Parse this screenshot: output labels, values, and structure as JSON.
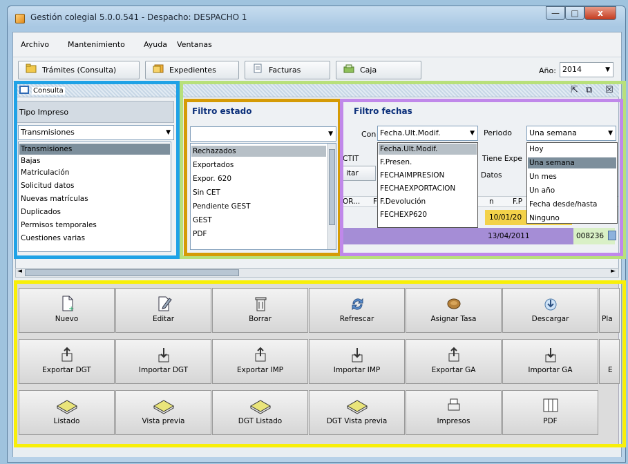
{
  "window": {
    "title": "Gestión colegial 5.0.0.541 - Despacho: DESPACHO 1",
    "controls": {
      "minimize": "—",
      "maximize": "□",
      "close": "x"
    }
  },
  "menu": [
    "Archivo",
    "Mantenimiento",
    "Ayuda",
    "Ventanas"
  ],
  "toolbar": {
    "buttons": [
      "Trámites (Consulta)",
      "Expedientes",
      "Facturas",
      "Caja"
    ],
    "year_label": "Año:",
    "year_value": "2014"
  },
  "consulta": {
    "title": "Consulta",
    "tipo_impreso": {
      "label": "Tipo Impreso",
      "selected": "Transmisiones",
      "items": [
        "Transmisiones",
        "Bajas",
        "Matriculación",
        "Solicitud datos",
        "Nuevas matrículas",
        "Duplicados",
        "Permisos temporales",
        "Cuestiones varias"
      ]
    },
    "filtro_estado": {
      "label": "Filtro estado",
      "selected": "",
      "items": [
        "Rechazados",
        "Exportados",
        "Expor. 620",
        "Sin CET",
        "Pendiente GEST",
        "GEST",
        "PDF"
      ]
    },
    "filtro_fechas": {
      "label": "Filtro fechas",
      "con_label": "Con",
      "con_selected": "Fecha.Ult.Modif.",
      "con_items": [
        "Fecha.Ult.Modif.",
        "F.Presen.",
        "FECHAIMPRESION",
        "FECHAEXPORTACION",
        "F.Devolución",
        "FECHEXP620"
      ],
      "periodo_label": "Periodo",
      "periodo_selected": "Una semana",
      "periodo_items": [
        "Hoy",
        "Una semana",
        "Un mes",
        "Un año",
        "Fecha desde/hasta",
        "Ninguno"
      ]
    },
    "grid_fragments": {
      "ctit": "CTIT",
      "tiene_expe": "Tiene Expe",
      "itar": "itar",
      "datos": "Datos",
      "col_or": "OR...",
      "col_f": "F",
      "col_n": "n",
      "col_fp": "F.P",
      "date1": "10/01/20",
      "date2": "13/04/2011",
      "code": "008236"
    }
  },
  "actions": [
    [
      {
        "label": "Nuevo",
        "icon": "new-document-icon"
      },
      {
        "label": "Editar",
        "icon": "edit-document-icon"
      },
      {
        "label": "Borrar",
        "icon": "trash-icon"
      },
      {
        "label": "Refrescar",
        "icon": "refresh-icon"
      },
      {
        "label": "Asignar Tasa",
        "icon": "coin-icon"
      },
      {
        "label": "Descargar",
        "icon": "download-icon"
      },
      {
        "label": "Pla",
        "icon": "blank-icon"
      }
    ],
    [
      {
        "label": "Exportar DGT",
        "icon": "export-icon"
      },
      {
        "label": "Importar DGT",
        "icon": "import-icon"
      },
      {
        "label": "Exportar IMP",
        "icon": "export-icon"
      },
      {
        "label": "Importar IMP",
        "icon": "import-icon"
      },
      {
        "label": "Exportar GA",
        "icon": "export-icon"
      },
      {
        "label": "Importar GA",
        "icon": "import-icon"
      },
      {
        "label": "E",
        "icon": "blank-icon"
      }
    ],
    [
      {
        "label": "Listado",
        "icon": "book-icon"
      },
      {
        "label": "Vista previa",
        "icon": "book-icon"
      },
      {
        "label": "DGT Listado",
        "icon": "book-icon"
      },
      {
        "label": "DGT Vista previa",
        "icon": "book-icon"
      },
      {
        "label": "Impresos",
        "icon": "printer-icon"
      },
      {
        "label": "PDF",
        "icon": "pdf-icon"
      }
    ]
  ],
  "colors": {
    "highlight_blue": "#1fa2e6",
    "highlight_green": "#b8e07a",
    "highlight_orange": "#d59b06",
    "highlight_purple": "#c088ea",
    "highlight_yellow": "#f8ef08"
  }
}
